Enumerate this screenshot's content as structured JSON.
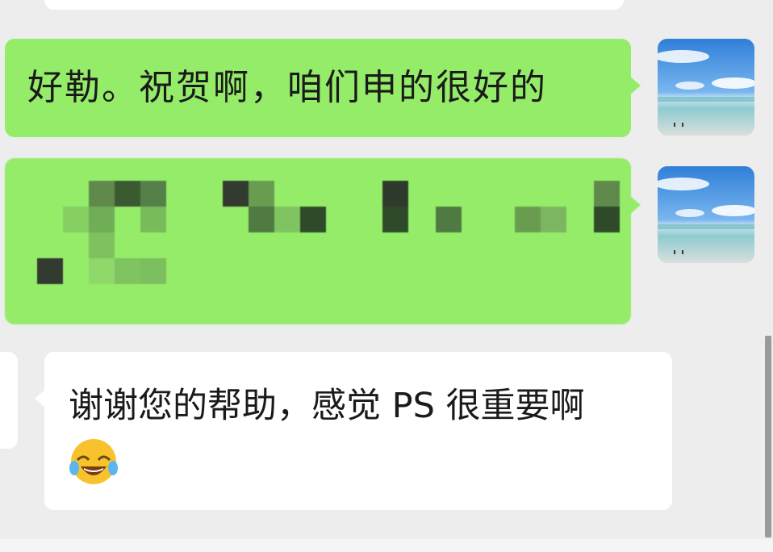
{
  "messages": [
    {
      "id": "m1",
      "side": "right",
      "bubble_color": "#95ec69",
      "text": "好勒。祝贺啊，咱们申的很好的"
    },
    {
      "id": "m2",
      "side": "right",
      "bubble_color": "#95ec69",
      "text": "",
      "pixelated": true
    },
    {
      "id": "m3",
      "side": "left",
      "bubble_color": "#ffffff",
      "text": "谢谢您的帮助，感觉 PS 很重要啊",
      "emoji": "tears-of-joy-emoji"
    }
  ],
  "avatar": {
    "icon": "beach-sky-avatar"
  },
  "colors": {
    "background": "#ededed",
    "self_bubble": "#95ec69",
    "other_bubble": "#ffffff"
  }
}
